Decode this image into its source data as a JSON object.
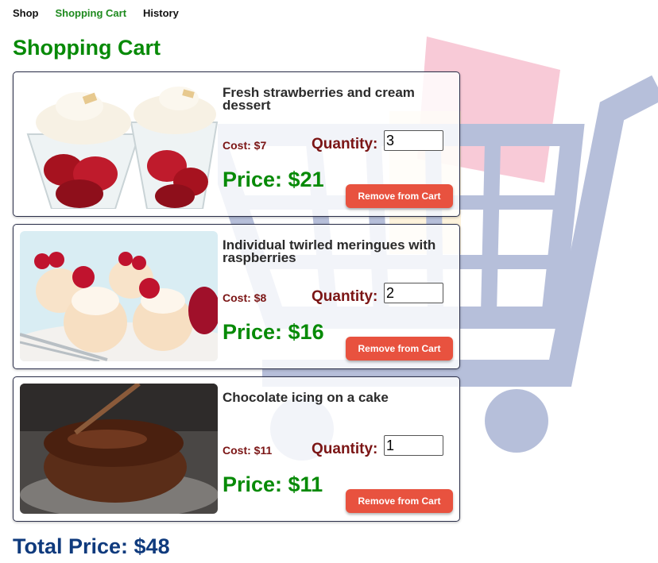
{
  "nav": {
    "items": [
      {
        "label": "Shop"
      },
      {
        "label": "Shopping Cart"
      },
      {
        "label": "History"
      }
    ]
  },
  "page_title": "Shopping Cart",
  "cost_prefix": "Cost:",
  "quantity_label": "Quantity:",
  "price_prefix": "Price:",
  "remove_label": "Remove from Cart",
  "items": [
    {
      "name": "Fresh strawberries and cream dessert",
      "cost": "Cost: $7",
      "quantity": "3",
      "price": "Price: $21",
      "quantity_label": "Quantity:",
      "remove_label": "Remove from Cart"
    },
    {
      "name": "Individual twirled meringues with raspberries",
      "cost": "Cost: $8",
      "quantity": "2",
      "price": "Price: $16",
      "quantity_label": "Quantity:",
      "remove_label": "Remove from Cart"
    },
    {
      "name": "Chocolate icing on a cake",
      "cost": "Cost: $11",
      "quantity": "1",
      "price": "Price: $11",
      "quantity_label": "Quantity:",
      "remove_label": "Remove from Cart"
    }
  ],
  "total": "Total Price: $48",
  "colors": {
    "accent_green": "#078a07",
    "cost_red": "#7b1515",
    "remove_button": "#e8523f",
    "total_blue": "#0f3a7d"
  },
  "icons": [
    "shopping-cart-background-icon"
  ]
}
